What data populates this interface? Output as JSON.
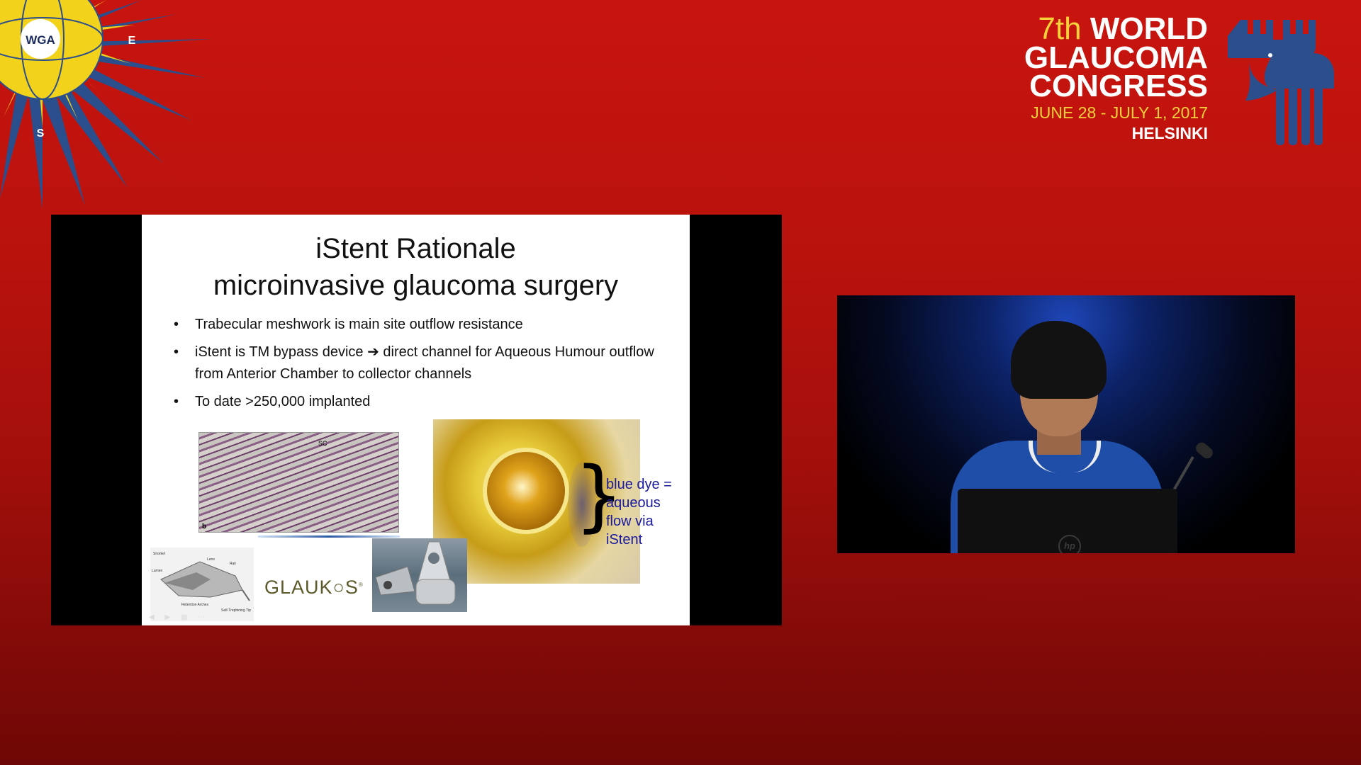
{
  "wga_logo": {
    "center": "WGA",
    "east": "E",
    "south": "S"
  },
  "congress": {
    "ordinal": "7th",
    "line1": "WORLD",
    "line2": "GLAUCOMA",
    "line3": "CONGRESS",
    "dates": "JUNE 28 - JULY 1, 2017",
    "city": "HELSINKI",
    "colors": {
      "accent": "#f5d23a",
      "text": "#ffffff",
      "moose": "#2b4f8c"
    }
  },
  "slide": {
    "title_line1": "iStent Rationale",
    "title_line2": "microinvasive glaucoma surgery",
    "bullets": [
      "Trabecular meshwork is main site outflow resistance",
      "iStent is TM bypass device ➔ direct channel for Aqueous Humour outflow from Anterior Chamber to collector channels",
      "To date >250,000 implanted"
    ],
    "histology_label": "b",
    "histology_sc": "SC",
    "eye_caption": "blue dye = aqueous flow via iStent",
    "brace": "}",
    "brand": "GLAUK",
    "brand_trademark": "®",
    "diagram_labels": [
      "Snorkel",
      "Lumen",
      "Lens",
      "Rail",
      "Retention Arches",
      "Self-Trephining Tip"
    ],
    "controls": "◀ ▶ ▦ ⋯"
  },
  "video": {
    "laptop_logo": "hp"
  }
}
